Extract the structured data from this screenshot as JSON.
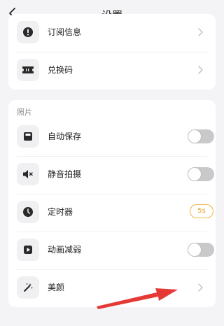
{
  "header": {
    "title": "设置"
  },
  "account": {
    "items": [
      {
        "label": "订阅信息",
        "icon": "alert-icon"
      },
      {
        "label": "兑换码",
        "icon": "ticket-icon"
      }
    ]
  },
  "photo": {
    "section_title": "照片",
    "auto_save": {
      "label": "自动保存",
      "enabled": false
    },
    "silent_shot": {
      "label": "静音拍摄",
      "enabled": false
    },
    "timer": {
      "label": "定时器",
      "value": "5s"
    },
    "reduce_motion": {
      "label": "动画减弱",
      "enabled": false
    },
    "beauty": {
      "label": "美颜"
    }
  },
  "colors": {
    "accent": "#f2b441",
    "toggle_off": "#c9c9c9",
    "annotation_arrow": "#e53935"
  }
}
